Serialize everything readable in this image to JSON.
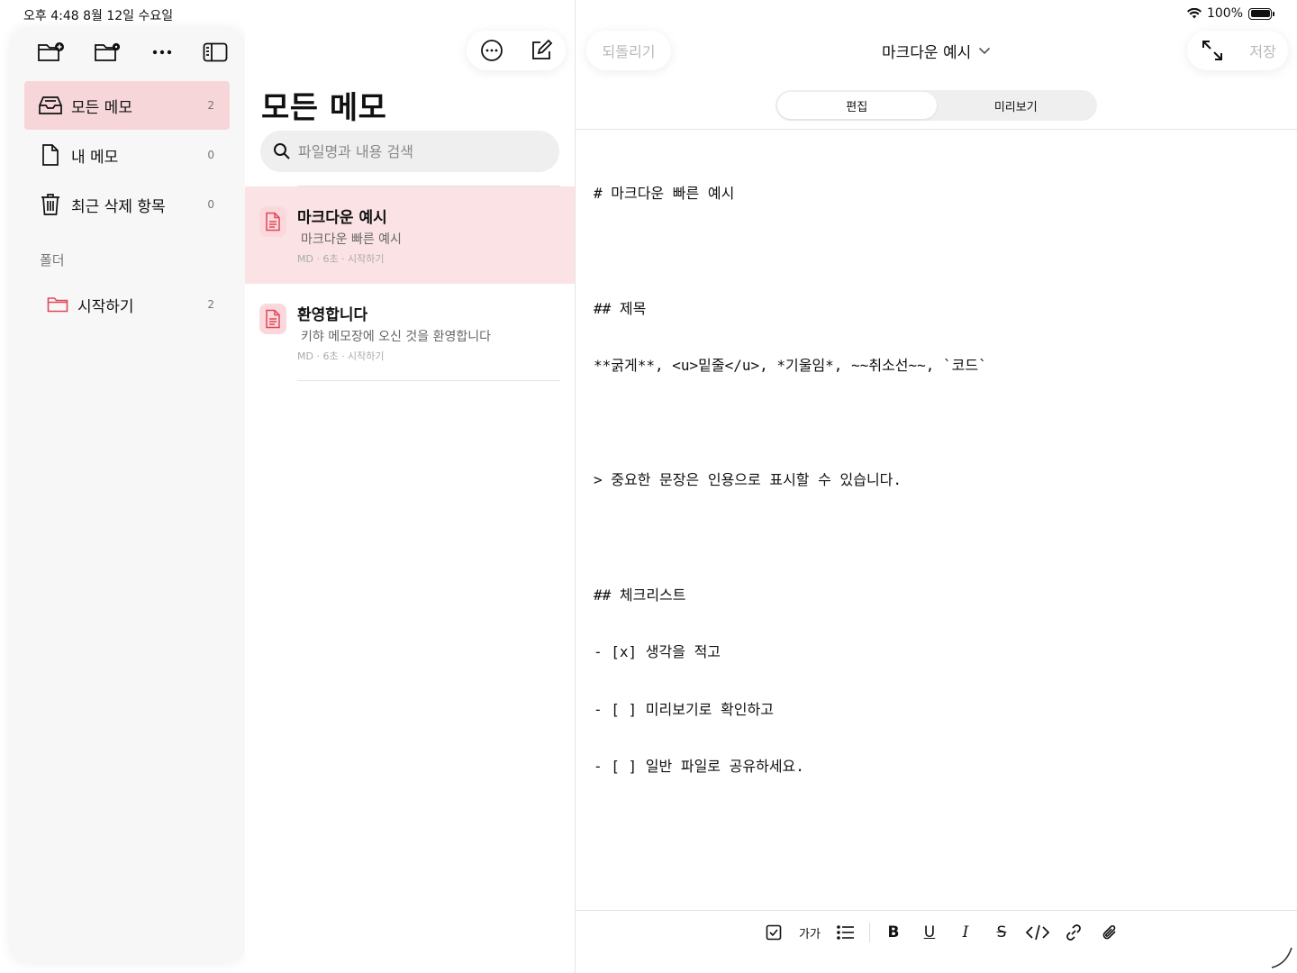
{
  "status_bar": {
    "time": "오후 4:48  8월 12일 수요일",
    "battery": "100%"
  },
  "sidebar": {
    "toolbar": {
      "icons": [
        "folder-plus-icon",
        "folder-settings-icon",
        "more-icon",
        "sidebar-toggle-icon"
      ]
    },
    "nav": [
      {
        "label": "모든 메모",
        "count": "2",
        "icon": "tray-icon",
        "active": true
      },
      {
        "label": "내 메모",
        "count": "0",
        "icon": "document-icon",
        "active": false
      },
      {
        "label": "최근 삭제 항목",
        "count": "0",
        "icon": "trash-icon",
        "active": false
      }
    ],
    "folder_header": "폴더",
    "folders": [
      {
        "label": "시작하기",
        "count": "2",
        "icon": "folder-icon"
      }
    ]
  },
  "list": {
    "title": "모든 메모",
    "search_placeholder": "파일명과 내용 검색",
    "notes": [
      {
        "title": "마크다운 예시",
        "preview": "마크다운 빠른 예시",
        "meta": "MD · 6초 · 시작하기",
        "selected": true
      },
      {
        "title": "환영합니다",
        "preview": "키햐 메모장에 오신 것을 환영합니다",
        "meta": "MD · 6초 · 시작하기",
        "selected": false
      }
    ]
  },
  "editor": {
    "undo_label": "되돌리기",
    "title": "마크다운 예시",
    "save_label": "저장",
    "tabs": {
      "edit": "편집",
      "preview": "미리보기"
    },
    "lines": [
      "# 마크다운 빠른 예시",
      "",
      "## 제목",
      "**굵게**, <u>밑줄</u>, *기울임*, ~~취소선~~, `코드`",
      "",
      "> 중요한 문장은 인용으로 표시할 수 있습니다.",
      "",
      "## 체크리스트",
      "- [x] 생각을 적고",
      "- [ ] 미리보기로 확인하고",
      "- [ ] 일반 파일로 공유하세요."
    ],
    "format_bar": {
      "font_size_label": "가가",
      "bold_label": "B",
      "underline_label": "U",
      "italic_label": "I",
      "strike_label": "S"
    }
  },
  "colors": {
    "accent": "#e0485a",
    "selected_bg": "#f6d6d9",
    "note_selected_bg": "#fbe2e5"
  }
}
